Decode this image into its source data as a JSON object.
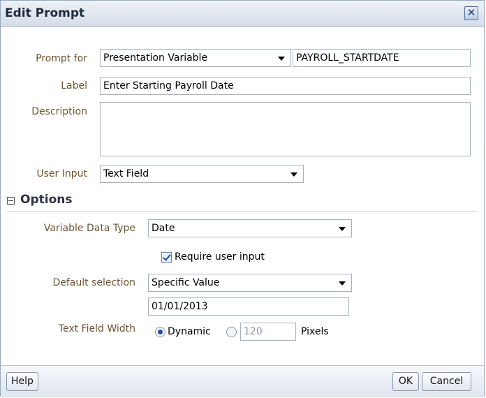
{
  "dialog": {
    "title": "Edit Prompt",
    "close_glyph": "✕"
  },
  "fields": {
    "prompt_for": {
      "label": "Prompt for",
      "select_value": "Presentation Variable",
      "variable_name": "PAYROLL_STARTDATE"
    },
    "label": {
      "label": "Label",
      "value": "Enter Starting Payroll Date"
    },
    "description": {
      "label": "Description",
      "value": ""
    },
    "user_input": {
      "label": "User Input",
      "select_value": "Text Field"
    }
  },
  "options": {
    "header": "Options",
    "variable_data_type": {
      "label": "Variable Data Type",
      "select_value": "Date"
    },
    "require_user_input": {
      "label": "Require user input",
      "checked": true
    },
    "default_selection": {
      "label": "Default selection",
      "select_value": "Specific Value",
      "value": "01/01/2013"
    },
    "text_field_width": {
      "label": "Text Field Width",
      "dynamic_label": "Dynamic",
      "pixels_value": "120",
      "pixels_label": "Pixels",
      "selected": "Dynamic"
    }
  },
  "footer": {
    "help_label": "Help",
    "ok_label": "OK",
    "cancel_label": "Cancel"
  },
  "icons": {
    "close": "close-icon",
    "collapse": "collapse-minus-icon",
    "dropdown": "chevron-down-icon"
  },
  "colors": {
    "label_text": "#6b5531",
    "accent": "#1d4fa0",
    "titlebar": "#d4dde9"
  }
}
